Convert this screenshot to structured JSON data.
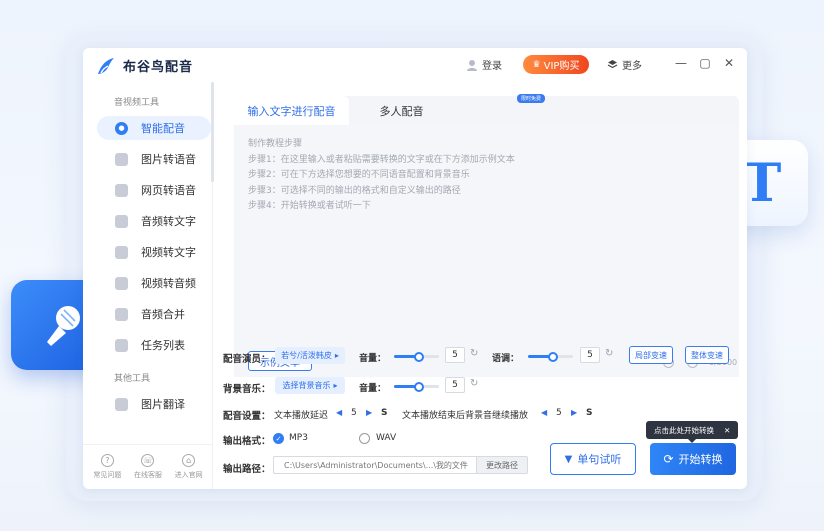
{
  "app": {
    "title": "布谷鸟配音",
    "login": "登录",
    "vip": "VIP购买",
    "more": "更多",
    "colors": {
      "accent": "#2f7ef5",
      "vip": "#f1461f"
    }
  },
  "sidebar": {
    "section_tools": "音视频工具",
    "section_other": "其他工具",
    "items": [
      {
        "label": "智能配音",
        "icon": "mic-icon"
      },
      {
        "label": "图片转语音",
        "icon": "image-icon"
      },
      {
        "label": "网页转语音",
        "icon": "web-icon"
      },
      {
        "label": "音频转文字",
        "icon": "audio-text-icon"
      },
      {
        "label": "视频转文字",
        "icon": "video-text-icon"
      },
      {
        "label": "视频转音频",
        "icon": "video-audio-icon"
      },
      {
        "label": "音频合并",
        "icon": "merge-icon"
      },
      {
        "label": "任务列表",
        "icon": "list-icon"
      }
    ],
    "other_items": [
      {
        "label": "图片翻译",
        "icon": "translate-icon"
      }
    ],
    "bottom": [
      {
        "label": "常见问题",
        "icon": "question-icon"
      },
      {
        "label": "在线客服",
        "icon": "service-icon"
      },
      {
        "label": "进入官网",
        "icon": "website-icon"
      }
    ]
  },
  "tabs": {
    "active": "输入文字进行配音",
    "multi": "多人配音",
    "badge": "限时免费"
  },
  "editor": {
    "steps": [
      "制作教程步骤",
      "步骤1：在这里输入或者粘贴需要转换的文字或在下方添加示例文本",
      "步骤2：可在下方选择您想要的不同语音配置和背景音乐",
      "步骤3：可选择不同的输出的格式和自定义输出的路径",
      "步骤4：开始转换或者试听一下"
    ],
    "sample_btn": "示例文本",
    "counter": "0/3000"
  },
  "settings": {
    "voice_label": "配音演员：",
    "voice_value": "若兮/活泼韩皮",
    "volume_label": "音量：",
    "volume_value": "5",
    "volume_level": 0.55,
    "speed_label": "语调：",
    "speed_value": "5",
    "speed_level": 0.55,
    "local_speed_btn": "局部变速",
    "global_speed_btn": "整体变速",
    "bgm_label": "背景音乐：",
    "bgm_value": "选择背景音乐",
    "bgm_volume_label": "音量：",
    "bgm_volume_value": "5",
    "bgm_volume_level": 0.55,
    "config_label": "配音设置：",
    "delay_label": "文本播放延迟",
    "delay_value": "5",
    "delay_unit": "S",
    "after_label": "文本播放结束后背景音继续播放",
    "after_value": "5",
    "after_unit": "S",
    "format_label": "输出格式：",
    "format_mp3": "MP3",
    "format_wav": "WAV",
    "path_label": "输出路径：",
    "path_value": "C:\\Users\\Administrator\\Documents\\...\\我的文件",
    "path_btn": "更改路径"
  },
  "actions": {
    "try": "单句试听",
    "start": "开始转换",
    "tooltip": "点击此处开始转换"
  },
  "decor": {
    "t_letter": "T"
  }
}
